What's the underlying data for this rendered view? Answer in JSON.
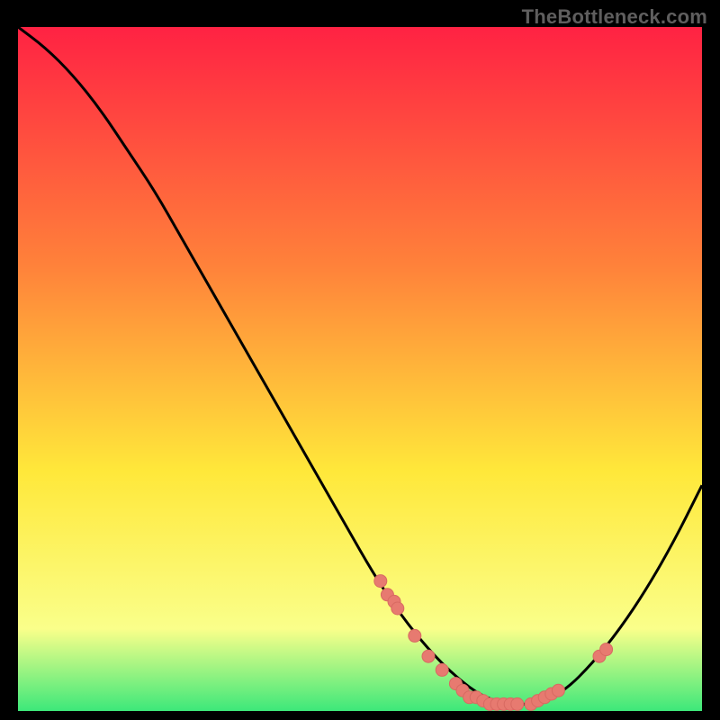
{
  "watermark": "TheBottleneck.com",
  "colors": {
    "background": "#000000",
    "gradient_top": "#ff2243",
    "gradient_mid_upper": "#ff823a",
    "gradient_mid": "#ffe83a",
    "gradient_low": "#faff8a",
    "gradient_bottom": "#3de87a",
    "curve": "#000000",
    "dot_fill": "#e77a70",
    "dot_stroke": "#d86a62"
  },
  "chart_data": {
    "type": "line",
    "title": "",
    "xlabel": "",
    "ylabel": "",
    "xlim": [
      0,
      100
    ],
    "ylim": [
      0,
      100
    ],
    "curve": {
      "x": [
        0,
        4,
        8,
        12,
        16,
        20,
        24,
        28,
        32,
        36,
        40,
        44,
        48,
        52,
        56,
        60,
        64,
        68,
        72,
        76,
        80,
        84,
        88,
        92,
        96,
        100
      ],
      "y": [
        100,
        97,
        93,
        88,
        82,
        76,
        69,
        62,
        55,
        48,
        41,
        34,
        27,
        20,
        14,
        9,
        5,
        2,
        1,
        1,
        3,
        7,
        12,
        18,
        25,
        33
      ]
    },
    "dots": [
      {
        "x": 53,
        "y": 19
      },
      {
        "x": 54,
        "y": 17
      },
      {
        "x": 55,
        "y": 16
      },
      {
        "x": 55.5,
        "y": 15
      },
      {
        "x": 58,
        "y": 11
      },
      {
        "x": 60,
        "y": 8
      },
      {
        "x": 62,
        "y": 6
      },
      {
        "x": 64,
        "y": 4
      },
      {
        "x": 65,
        "y": 3
      },
      {
        "x": 66,
        "y": 2
      },
      {
        "x": 67,
        "y": 2
      },
      {
        "x": 68,
        "y": 1.5
      },
      {
        "x": 69,
        "y": 1
      },
      {
        "x": 70,
        "y": 1
      },
      {
        "x": 71,
        "y": 1
      },
      {
        "x": 72,
        "y": 1
      },
      {
        "x": 73,
        "y": 1
      },
      {
        "x": 75,
        "y": 1
      },
      {
        "x": 76,
        "y": 1.5
      },
      {
        "x": 77,
        "y": 2
      },
      {
        "x": 78,
        "y": 2.5
      },
      {
        "x": 79,
        "y": 3
      },
      {
        "x": 85,
        "y": 8
      },
      {
        "x": 86,
        "y": 9
      }
    ]
  }
}
